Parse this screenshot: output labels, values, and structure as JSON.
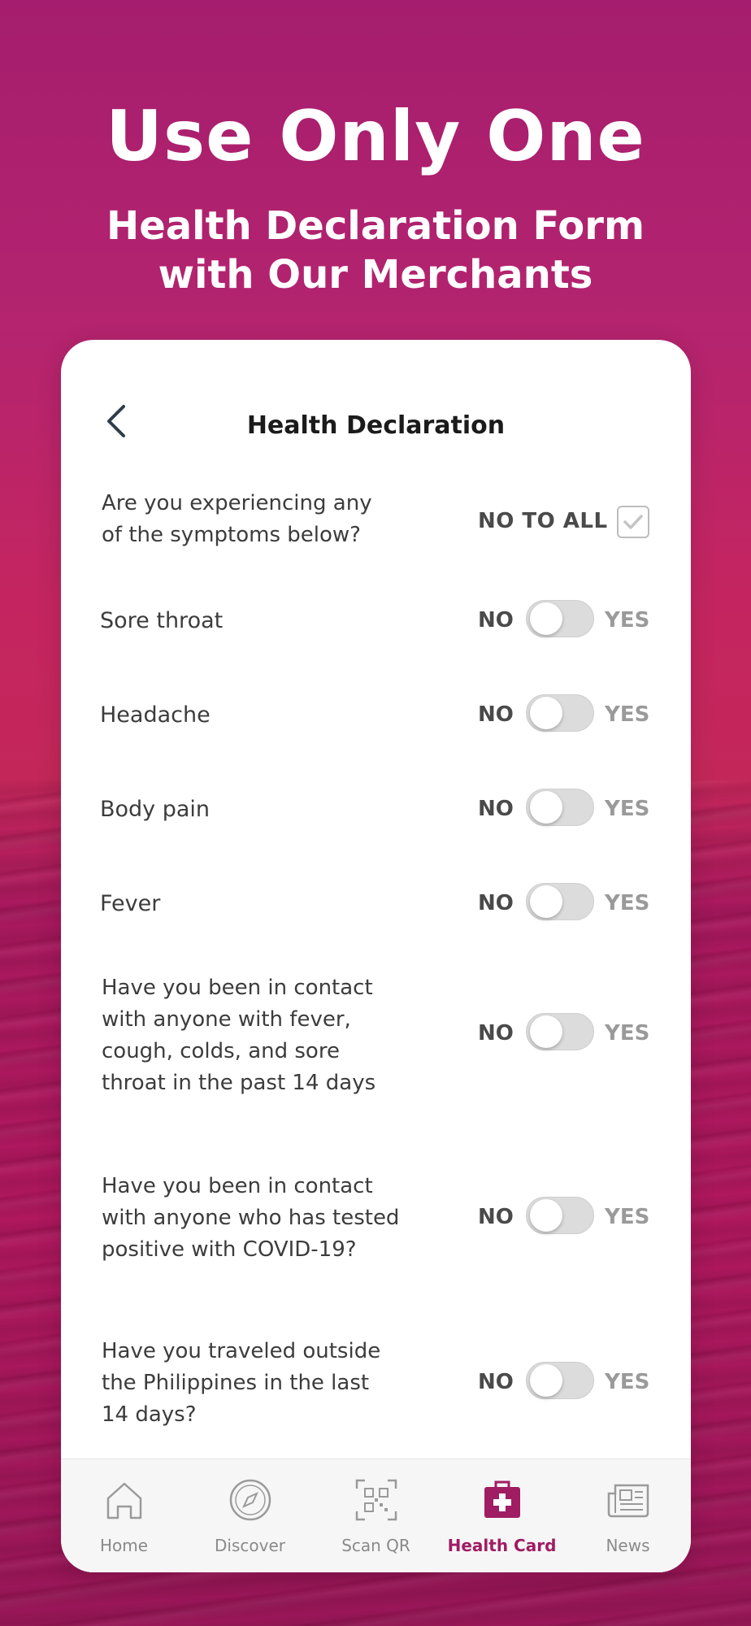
{
  "hero": {
    "title": "Use Only One",
    "subtitle_line1": "Health Declaration Form",
    "subtitle_line2": "with Our Merchants"
  },
  "screen": {
    "title": "Health Declaration",
    "no_to_all": {
      "question_line1": "Are you experiencing any",
      "question_line2": "of the symptoms below?",
      "label": "NO TO ALL",
      "checked": true
    },
    "symptoms": [
      {
        "label": "Sore throat",
        "no": "NO",
        "yes": "YES",
        "value": false
      },
      {
        "label": "Headache",
        "no": "NO",
        "yes": "YES",
        "value": false
      },
      {
        "label": "Body pain",
        "no": "NO",
        "yes": "YES",
        "value": false
      },
      {
        "label": "Fever",
        "no": "NO",
        "yes": "YES",
        "value": false
      }
    ],
    "questions": [
      {
        "lines": [
          "Have you been in contact",
          "with anyone with fever,",
          "cough, colds, and sore",
          "throat in the past 14 days"
        ],
        "no": "NO",
        "yes": "YES",
        "value": false
      },
      {
        "lines": [
          "Have you been in contact",
          "with anyone who has tested",
          "positive with COVID-19?"
        ],
        "no": "NO",
        "yes": "YES",
        "value": false
      },
      {
        "lines": [
          "Have you traveled outside",
          "the Philippines in the last",
          "14 days?"
        ],
        "no": "NO",
        "yes": "YES",
        "value": false
      }
    ]
  },
  "tabbar": {
    "items": [
      {
        "label": "Home",
        "icon": "home-icon",
        "active": false
      },
      {
        "label": "Discover",
        "icon": "compass-icon",
        "active": false
      },
      {
        "label": "Scan QR",
        "icon": "qr-scan-icon",
        "active": false
      },
      {
        "label": "Health Card",
        "icon": "medical-kit-icon",
        "active": true
      },
      {
        "label": "News",
        "icon": "newspaper-icon",
        "active": false
      }
    ]
  },
  "colors": {
    "brand": "#a01c63",
    "background": "#b4246f",
    "toggle_off": "#dcdcdc"
  }
}
